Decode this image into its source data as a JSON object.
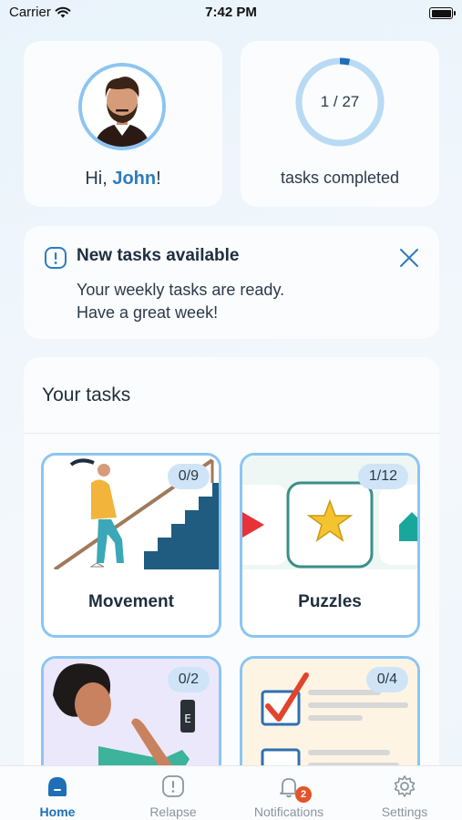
{
  "status_bar": {
    "carrier": "Carrier",
    "time": "7:42 PM"
  },
  "profile": {
    "greeting_prefix": "Hi, ",
    "name": "John",
    "greeting_suffix": "!"
  },
  "progress": {
    "completed": 1,
    "total": 27,
    "text": "1 / 27",
    "label": "tasks completed"
  },
  "banner": {
    "title": "New tasks available",
    "line1": "Your weekly tasks are ready.",
    "line2": "Have a great week!"
  },
  "tasks": {
    "header": "Your tasks",
    "tiles": [
      {
        "label": "Movement",
        "count": "0/9"
      },
      {
        "label": "Puzzles",
        "count": "1/12"
      },
      {
        "label": "",
        "count": "0/2"
      },
      {
        "label": "",
        "count": "0/4"
      }
    ]
  },
  "tab_bar": {
    "items": [
      {
        "label": "Home",
        "icon": "home-icon"
      },
      {
        "label": "Relapse",
        "icon": "alert-icon"
      },
      {
        "label": "Notifications",
        "icon": "bell-icon",
        "badge": "2"
      },
      {
        "label": "Settings",
        "icon": "gear-icon"
      }
    ]
  },
  "colors": {
    "accent": "#1e6fb7",
    "tile_border": "#8cc5f2",
    "badge": "#e3542b"
  }
}
